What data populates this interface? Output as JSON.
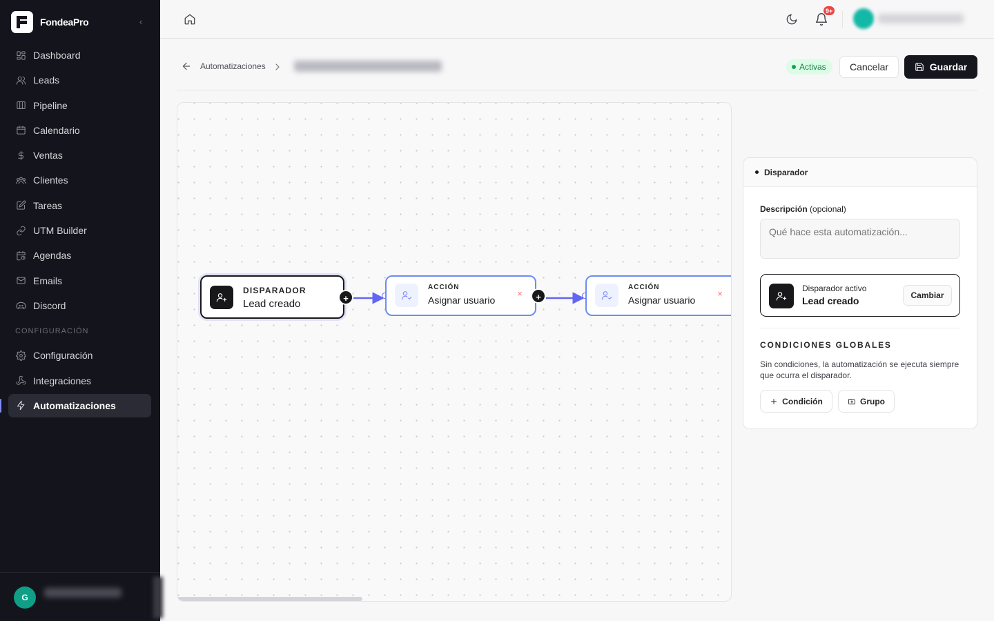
{
  "app": {
    "name": "FondeaPro",
    "collapse_glyph": "‹"
  },
  "sidebar": {
    "items": [
      {
        "label": "Dashboard",
        "icon": "dashboard-icon"
      },
      {
        "label": "Leads",
        "icon": "users-icon"
      },
      {
        "label": "Pipeline",
        "icon": "columns-icon"
      },
      {
        "label": "Calendario",
        "icon": "calendar-icon"
      },
      {
        "label": "Ventas",
        "icon": "dollar-icon"
      },
      {
        "label": "Clientes",
        "icon": "group-icon"
      },
      {
        "label": "Tareas",
        "icon": "edit-icon"
      },
      {
        "label": "UTM Builder",
        "icon": "link-icon"
      },
      {
        "label": "Agendas",
        "icon": "calendar-clock-icon"
      },
      {
        "label": "Emails",
        "icon": "mail-icon"
      },
      {
        "label": "Discord",
        "icon": "discord-icon"
      }
    ],
    "section_label": "CONFIGURACIÓN",
    "config_items": [
      {
        "label": "Configuración",
        "icon": "gear-icon"
      },
      {
        "label": "Integraciones",
        "icon": "webhook-icon"
      },
      {
        "label": "Automatizaciones",
        "icon": "bolt-icon",
        "active": true
      }
    ],
    "user_initial": "G"
  },
  "topbar": {
    "notification_badge": "9+"
  },
  "header": {
    "breadcrumb": "Automatizaciones",
    "status": "Activas",
    "cancel_label": "Cancelar",
    "save_label": "Guardar"
  },
  "canvas": {
    "trigger_node": {
      "kicker": "DISPARADOR",
      "title": "Lead creado"
    },
    "action_nodes": [
      {
        "kicker": "ACCIÓN",
        "title": "Asignar usuario"
      },
      {
        "kicker": "ACCIÓN",
        "title": "Asignar usuario"
      }
    ],
    "add_glyph": "+",
    "close_glyph": "×",
    "edge_color": "#6366f1"
  },
  "panel": {
    "title": "Disparador",
    "description_label": "Descripción",
    "description_optional": "(opcional)",
    "description_placeholder": "Qué hace esta automatización...",
    "trigger_label": "Disparador activo",
    "trigger_value": "Lead creado",
    "change_label": "Cambiar",
    "conditions_title": "CONDICIONES GLOBALES",
    "conditions_desc": "Sin condiciones, la automatización se ejecuta siempre que ocurra el disparador.",
    "add_condition_label": "Condición",
    "add_group_label": "Grupo"
  },
  "colors": {
    "sidebar_bg": "#14151c",
    "accent": "#6366f1",
    "status_green": "#16a34a",
    "badge_red": "#ef4444"
  }
}
